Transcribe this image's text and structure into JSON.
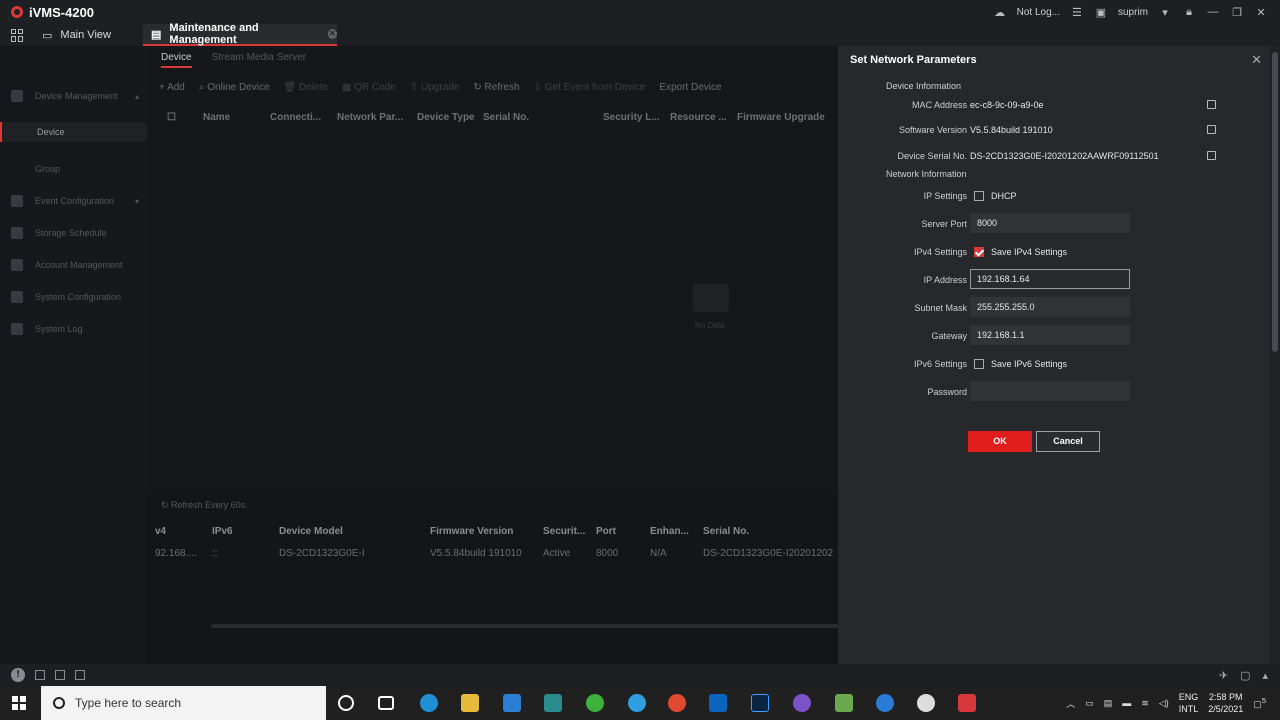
{
  "app": {
    "title": "iVMS-4200"
  },
  "titlebar": {
    "cloud_status": "Not Log...",
    "user": "suprim"
  },
  "tabs": {
    "main_view": "Main View",
    "maintenance": "Maintenance and Management"
  },
  "sidebar": {
    "items": [
      {
        "label": "Device Management",
        "expandable": true
      },
      {
        "label": "Device",
        "sub": true,
        "active": true
      },
      {
        "label": "Group",
        "sub": true
      },
      {
        "label": "Event Configuration",
        "expandable": true
      },
      {
        "label": "Storage Schedule"
      },
      {
        "label": "Account Management"
      },
      {
        "label": "System Configuration"
      },
      {
        "label": "System Log"
      }
    ]
  },
  "main": {
    "subtabs": [
      "Device",
      "Stream Media Server"
    ],
    "toolbar": [
      "Add",
      "Online Device",
      "Delete",
      "QR Code",
      "Upgrade",
      "Refresh",
      "Get Event from Device",
      "Export Device"
    ],
    "columns": [
      "Name",
      "Connecti...",
      "Network Par...",
      "Device Type",
      "Serial No.",
      "Security L...",
      "Resource ...",
      "Firmware Upgrade"
    ],
    "no_data": "No Data",
    "refresh_label": "Refresh Every 60s.",
    "online_columns": [
      "v4",
      "IPv6",
      "Device Model",
      "Firmware Version",
      "Securit...",
      "Port",
      "Enhan...",
      "Serial No."
    ],
    "online_row": [
      "92.168....",
      "::",
      "DS-2CD1323G0E-I",
      "V5.5.84build 191010",
      "Active",
      "8000",
      "N/A",
      "DS-2CD1323G0E-I20201202"
    ]
  },
  "dialog": {
    "title": "Set Network Parameters",
    "device_info_heading": "Device Information",
    "mac_label": "MAC Address",
    "mac_value": "ec-c8-9c-09-a9-0e",
    "sw_label": "Software Version",
    "sw_value": "V5.5.84build 191010",
    "serial_label": "Device Serial No.",
    "serial_value": "DS-2CD1323G0E-I20201202AAWRF09112501",
    "network_heading": "Network Information",
    "ip_settings_label": "IP Settings",
    "dhcp_label": "DHCP",
    "dhcp_checked": false,
    "server_port_label": "Server Port",
    "server_port_value": "8000",
    "ipv4_settings_label": "IPv4 Settings",
    "save_ipv4_label": "Save IPv4 Settings",
    "save_ipv4_checked": true,
    "ip_label": "IP Address",
    "ip_value": "192.168.1.64",
    "subnet_label": "Subnet Mask",
    "subnet_value": "255.255.255.0",
    "gateway_label": "Gateway",
    "gateway_value": "192.168.1.1",
    "ipv6_settings_label": "IPv6 Settings",
    "save_ipv6_label": "Save IPv6 Settings",
    "save_ipv6_checked": false,
    "password_label": "Password",
    "password_value": "",
    "ok_label": "OK",
    "cancel_label": "Cancel"
  },
  "taskbar": {
    "search_placeholder": "Type here to search",
    "lang_top": "ENG",
    "lang_bottom": "INTL",
    "time": "2:58 PM",
    "date": "2/5/2021",
    "notification_count": "5"
  },
  "colors": {
    "accent": "#d9383a",
    "ok_button": "#e01e1e"
  }
}
